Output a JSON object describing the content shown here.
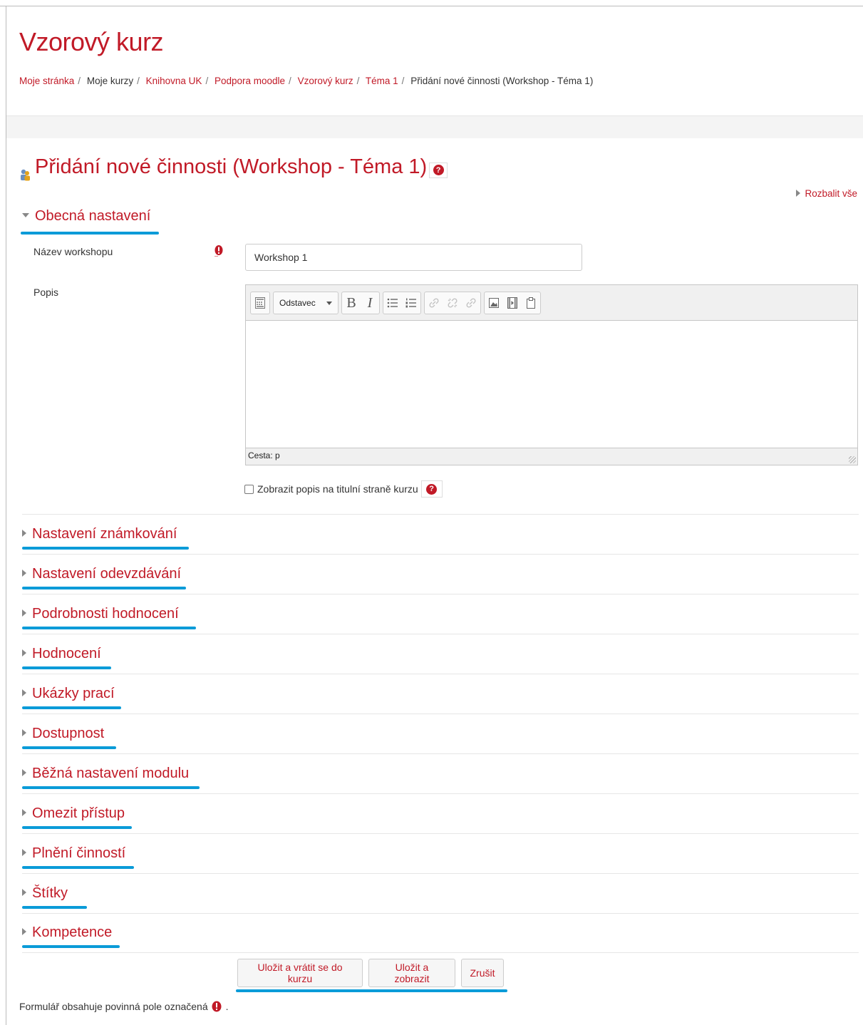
{
  "course": {
    "title": "Vzorový kurz"
  },
  "breadcrumb": [
    "Moje stránka",
    "Moje kurzy",
    "Knihovna UK",
    "Podpora moodle",
    "Vzorový kurz",
    "Téma 1",
    "Přidání nové činnosti (Workshop - Téma 1)"
  ],
  "page": {
    "heading": "Přidání nové činnosti (Workshop - Téma 1)",
    "expand_all": "Rozbalit vše"
  },
  "general": {
    "section_title": "Obecná nastavení",
    "name_label": "Název workshopu",
    "name_value": "Workshop 1",
    "description_label": "Popis",
    "editor_format": "Odstavec",
    "editor_path": "Cesta: p",
    "show_description_label": "Zobrazit popis na titulní straně kurzu"
  },
  "sections": [
    "Nastavení známkování",
    "Nastavení odevzdávání",
    "Podrobnosti hodnocení",
    "Hodnocení",
    "Ukázky prací",
    "Dostupnost",
    "Běžná nastavení modulu",
    "Omezit přístup",
    "Plnění činností",
    "Štítky",
    "Kompetence"
  ],
  "buttons": {
    "save_return": "Uložit a vrátit se do kurzu",
    "save_display": "Uložit a zobrazit",
    "cancel": "Zrušit"
  },
  "footer": {
    "required_note": "Formulář obsahuje povinná pole označená",
    "required_note_end": "."
  },
  "colors": {
    "accent": "#c11a27",
    "highlight": "#0a9bd8",
    "band": "#f4f4f4"
  }
}
